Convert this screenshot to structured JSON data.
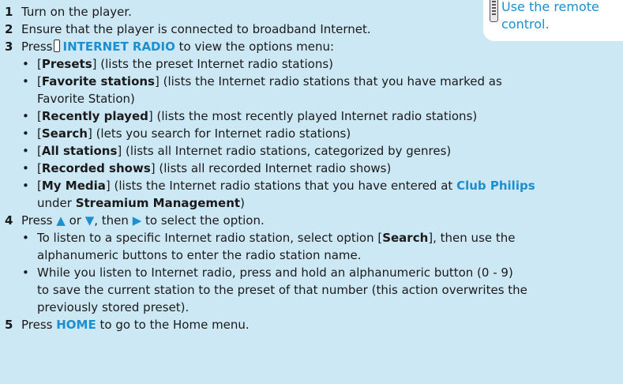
{
  "tip": {
    "line1": "Use the remote",
    "line2": "control."
  },
  "steps": {
    "s1": {
      "num": "1",
      "text": "Turn on the player."
    },
    "s2": {
      "num": "2",
      "text": "Ensure that the player is connected to broadband Internet."
    },
    "s3": {
      "num": "3",
      "pre": "Press",
      "key": "INTERNET RADIO",
      "post": " to view the options menu:"
    },
    "s4": {
      "num": "4",
      "pre": "Press",
      "up": "▲",
      "or": " or ",
      "down": "▼",
      "then": ", then ",
      "right": "▶",
      "post": " to select the option."
    },
    "s5": {
      "num": "5",
      "pre": "Press ",
      "key": "HOME",
      "post": " to go to the Home menu."
    }
  },
  "options": {
    "presets": {
      "label": "Presets",
      "desc": " (lists the preset Internet radio stations)"
    },
    "favorites": {
      "label": "Favorite stations",
      "desc": " (lists the Internet radio stations that you have marked as",
      "desc2": "Favorite Station)"
    },
    "recent": {
      "label": "Recently played",
      "desc": " (lists the most recently played Internet radio stations)"
    },
    "search": {
      "label": "Search",
      "desc": " (lets you search for Internet radio stations)"
    },
    "all": {
      "label": "All stations",
      "desc": " (lists all Internet radio stations, categorized by genres)"
    },
    "recorded": {
      "label": "Recorded shows",
      "desc": " (lists all recorded Internet radio shows)"
    },
    "mymedia": {
      "label": "My Media",
      "desc": " (lists the Internet radio stations that you have entered at ",
      "club": "Club Philips",
      "desc2a": "under ",
      "mgmt": "Streamium Management",
      "desc2b": ")"
    }
  },
  "subs": {
    "a": {
      "pre": "To listen to a specific Internet radio station, select option [",
      "opt": "Search",
      "post": "], then use the",
      "line2": "alphanumeric buttons to enter the radio station name."
    },
    "b": {
      "line1": "While you listen to Internet radio, press and hold an alphanumeric button (0 - 9)",
      "line2": "to save the current station to the preset of that number (this action overwrites the",
      "line3": "previously stored preset)."
    }
  },
  "bullet": "•"
}
